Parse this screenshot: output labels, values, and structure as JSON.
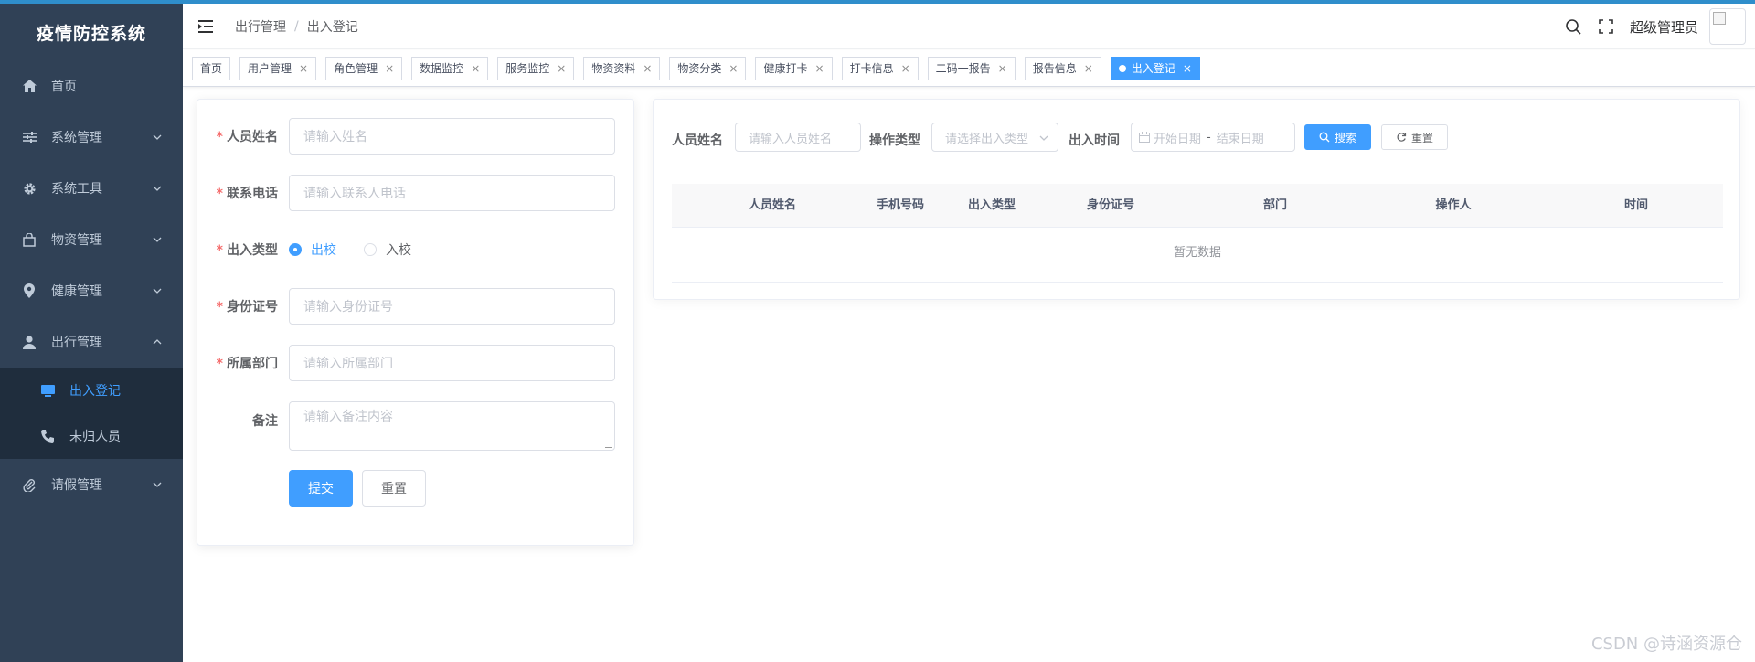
{
  "app": {
    "title": "疫情防控系统"
  },
  "sidebar": {
    "items": [
      {
        "label": "首页",
        "icon": "home-icon"
      },
      {
        "label": "系统管理",
        "icon": "sliders-icon"
      },
      {
        "label": "系统工具",
        "icon": "gear-icon"
      },
      {
        "label": "物资管理",
        "icon": "bag-icon"
      },
      {
        "label": "健康管理",
        "icon": "location-pin-icon"
      },
      {
        "label": "出行管理",
        "icon": "user-icon",
        "expanded": true
      },
      {
        "label": "请假管理",
        "icon": "paperclip-icon"
      }
    ],
    "sub_items": [
      {
        "label": "出入登记",
        "icon": "monitor-icon",
        "active": true
      },
      {
        "label": "未归人员",
        "icon": "phone-icon"
      }
    ]
  },
  "header": {
    "breadcrumb": [
      "出行管理",
      "出入登记"
    ],
    "separator": "/",
    "username": "超级管理员"
  },
  "tags": [
    {
      "label": "首页",
      "closable": false
    },
    {
      "label": "用户管理",
      "closable": true
    },
    {
      "label": "角色管理",
      "closable": true
    },
    {
      "label": "数据监控",
      "closable": true
    },
    {
      "label": "服务监控",
      "closable": true
    },
    {
      "label": "物资资料",
      "closable": true
    },
    {
      "label": "物资分类",
      "closable": true
    },
    {
      "label": "健康打卡",
      "closable": true
    },
    {
      "label": "打卡信息",
      "closable": true
    },
    {
      "label": "二码一报告",
      "closable": true
    },
    {
      "label": "报告信息",
      "closable": true
    },
    {
      "label": "出入登记",
      "closable": true,
      "active": true
    }
  ],
  "form": {
    "name": {
      "label": "人员姓名",
      "placeholder": "请输入姓名",
      "required": true
    },
    "phone": {
      "label": "联系电话",
      "placeholder": "请输入联系人电话",
      "required": true
    },
    "type": {
      "label": "出入类型",
      "required": true,
      "options": [
        "出校",
        "入校"
      ],
      "selected": "出校"
    },
    "idcard": {
      "label": "身份证号",
      "placeholder": "请输入身份证号",
      "required": true
    },
    "dept": {
      "label": "所属部门",
      "placeholder": "请输入所属部门",
      "required": true
    },
    "remark": {
      "label": "备注",
      "placeholder": "请输入备注内容",
      "required": false
    },
    "submit_label": "提交",
    "reset_label": "重置",
    "required_mark": "*"
  },
  "query": {
    "name_label": "人员姓名",
    "name_placeholder": "请输入人员姓名",
    "type_label": "操作类型",
    "type_placeholder": "请选择出入类型",
    "time_label": "出入时间",
    "start_placeholder": "开始日期",
    "range_sep": "-",
    "end_placeholder": "结束日期",
    "search_label": "搜索",
    "reset_label": "重置"
  },
  "table": {
    "columns": [
      "人员姓名",
      "手机号码",
      "出入类型",
      "身份证号",
      "部门",
      "操作人",
      "时间"
    ],
    "rows": [],
    "empty_text": "暂无数据"
  },
  "watermark": "CSDN @诗涵资源仓",
  "colors": {
    "sidebar_bg": "#304156",
    "primary": "#409eff",
    "required": "#f56c6c"
  }
}
